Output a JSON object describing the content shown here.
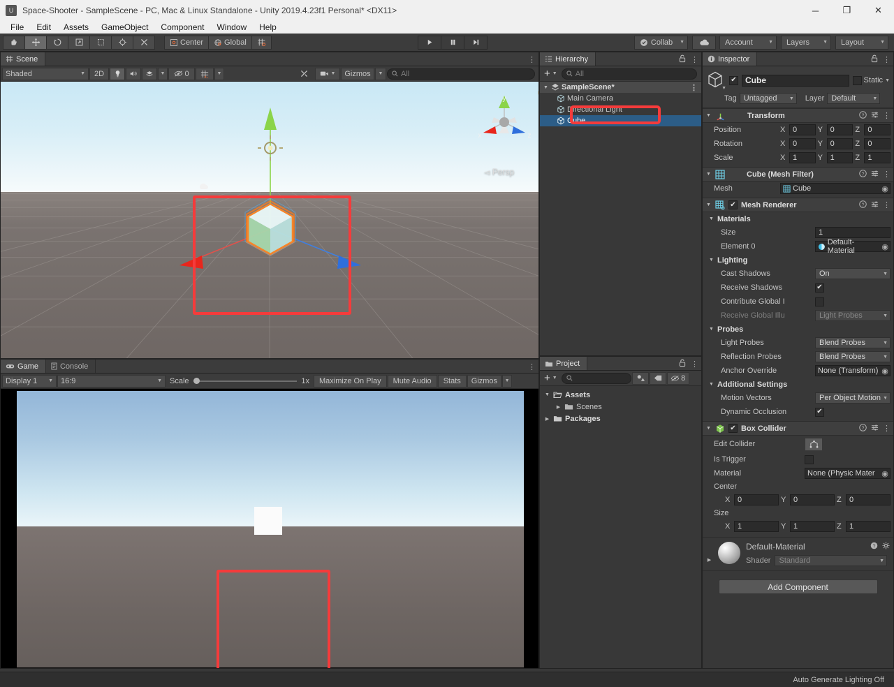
{
  "window": {
    "title": "Space-Shooter - SampleScene - PC, Mac & Linux Standalone - Unity 2019.4.23f1 Personal* <DX11>",
    "minimize": "─",
    "maximize": "❐",
    "close": "✕"
  },
  "menubar": {
    "items": [
      "File",
      "Edit",
      "Assets",
      "GameObject",
      "Component",
      "Window",
      "Help"
    ]
  },
  "toolbar": {
    "tools": [
      {
        "name": "hand-tool",
        "glyph": "✋"
      },
      {
        "name": "move-tool",
        "glyph": "✥"
      },
      {
        "name": "rotate-tool",
        "glyph": "↻"
      },
      {
        "name": "scale-tool",
        "glyph": "⤡"
      },
      {
        "name": "rect-tool",
        "glyph": "⬚"
      },
      {
        "name": "transform-tool",
        "glyph": "⌖"
      },
      {
        "name": "custom-tool",
        "glyph": "⚒"
      }
    ],
    "pivot_label": "Center",
    "space_label": "Global",
    "snap_label": "grid-snapping",
    "play": "▶",
    "pause": "❙❙",
    "step": "▶❙",
    "collab_label": "Collab",
    "cloud_label": "cloud",
    "account_label": "Account",
    "layers_label": "Layers",
    "layout_label": "Layout"
  },
  "scene_panel": {
    "tab_label": "Scene",
    "shading_mode": "Shaded",
    "twod_label": "2D",
    "lighting_icon": "light-bulb-icon",
    "audio_icon": "audio-icon",
    "fx_icon": "effects-icon",
    "hidden_count": "0",
    "grid_icon": "grid-icon",
    "tools_icon": "scene-tools-icon",
    "camera_icon": "scene-camera-icon",
    "gizmos_label": "Gizmos",
    "search_placeholder": "All",
    "axis_x": "x",
    "axis_y": "y",
    "axis_z": "z",
    "persp_label": "Persp"
  },
  "game_panel": {
    "tabs": [
      {
        "label": "Game",
        "icon": "gamepad-icon",
        "active": true
      },
      {
        "label": "Console",
        "icon": "console-icon",
        "active": false
      }
    ],
    "display": "Display 1",
    "aspect": "16:9",
    "scale_label": "Scale",
    "scale_value": "1x",
    "maximize_label": "Maximize On Play",
    "mute_label": "Mute Audio",
    "stats_label": "Stats",
    "gizmos_label": "Gizmos"
  },
  "hierarchy": {
    "tab_label": "Hierarchy",
    "add_label": "+",
    "search_placeholder": "All",
    "items": [
      {
        "label": "SampleScene*",
        "depth": 0,
        "icon": "scene-icon",
        "selected": false,
        "expanded": true
      },
      {
        "label": "Main Camera",
        "depth": 1,
        "icon": "gameobject-icon",
        "selected": false
      },
      {
        "label": "Directional Light",
        "depth": 1,
        "icon": "gameobject-icon",
        "selected": false
      },
      {
        "label": "Cube",
        "depth": 1,
        "icon": "gameobject-icon",
        "selected": true
      }
    ]
  },
  "project": {
    "tab_label": "Project",
    "add_label": "+",
    "search_placeholder": "",
    "filter_type_icon": "type-filter-icon",
    "filter_label_icon": "label-filter-icon",
    "visibility_count": "8",
    "items": [
      {
        "label": "Assets",
        "depth": 0,
        "expanded": true,
        "arrow": "▼"
      },
      {
        "label": "Scenes",
        "depth": 1,
        "expanded": false,
        "arrow": "▶"
      },
      {
        "label": "Packages",
        "depth": 0,
        "expanded": false,
        "arrow": "▶"
      }
    ]
  },
  "inspector": {
    "tab_label": "Inspector",
    "lock_icon": "lock-icon",
    "menu_icon": "kebab-menu-icon",
    "object_enabled": true,
    "object_name": "Cube",
    "static_label": "Static",
    "static_checked": false,
    "tag_label": "Tag",
    "tag_value": "Untagged",
    "layer_label": "Layer",
    "layer_value": "Default",
    "transform": {
      "title": "Transform",
      "position_label": "Position",
      "rotation_label": "Rotation",
      "scale_label": "Scale",
      "axes": [
        "X",
        "Y",
        "Z"
      ],
      "position": [
        "0",
        "0",
        "0"
      ],
      "rotation": [
        "0",
        "0",
        "0"
      ],
      "scale": [
        "1",
        "1",
        "1"
      ]
    },
    "mesh_filter": {
      "title": "Cube (Mesh Filter)",
      "mesh_label": "Mesh",
      "mesh_value": "Cube"
    },
    "mesh_renderer": {
      "title": "Mesh Renderer",
      "enabled": true,
      "materials_label": "Materials",
      "size_label": "Size",
      "size_value": "1",
      "element0_label": "Element 0",
      "element0_value": "Default-Material",
      "lighting_label": "Lighting",
      "cast_shadows_label": "Cast Shadows",
      "cast_shadows_value": "On",
      "receive_shadows_label": "Receive Shadows",
      "receive_shadows_checked": true,
      "contribute_gi_label": "Contribute Global I",
      "contribute_gi_checked": false,
      "receive_gi_label": "Receive Global Illu",
      "receive_gi_value": "Light Probes",
      "probes_label": "Probes",
      "light_probes_label": "Light Probes",
      "light_probes_value": "Blend Probes",
      "reflection_probes_label": "Reflection Probes",
      "reflection_probes_value": "Blend Probes",
      "anchor_override_label": "Anchor Override",
      "anchor_override_value": "None (Transform)",
      "additional_label": "Additional Settings",
      "motion_vectors_label": "Motion Vectors",
      "motion_vectors_value": "Per Object Motion",
      "dynamic_occlusion_label": "Dynamic Occlusion",
      "dynamic_occlusion_checked": true
    },
    "box_collider": {
      "title": "Box Collider",
      "enabled": true,
      "edit_collider_label": "Edit Collider",
      "edit_collider_icon": "edit-collider-icon",
      "is_trigger_label": "Is Trigger",
      "is_trigger_checked": false,
      "material_label": "Material",
      "material_value": "None (Physic Mater",
      "center_label": "Center",
      "center": [
        "0",
        "0",
        "0"
      ],
      "size_label": "Size",
      "size": [
        "1",
        "1",
        "1"
      ],
      "axes": [
        "X",
        "Y",
        "Z"
      ]
    },
    "material": {
      "name": "Default-Material",
      "shader_label": "Shader",
      "shader_value": "Standard",
      "help_icon": "help-icon",
      "settings_icon": "gear-icon"
    },
    "add_component_label": "Add Component"
  },
  "statusbar": {
    "text": "Auto Generate Lighting Off"
  },
  "colors": {
    "annotation": "#f53b3b",
    "selection": "#2c5d87",
    "panel_bg": "#383838",
    "axis_x": "#e1514b",
    "axis_y": "#8bd449",
    "axis_z": "#3f7fe0"
  }
}
